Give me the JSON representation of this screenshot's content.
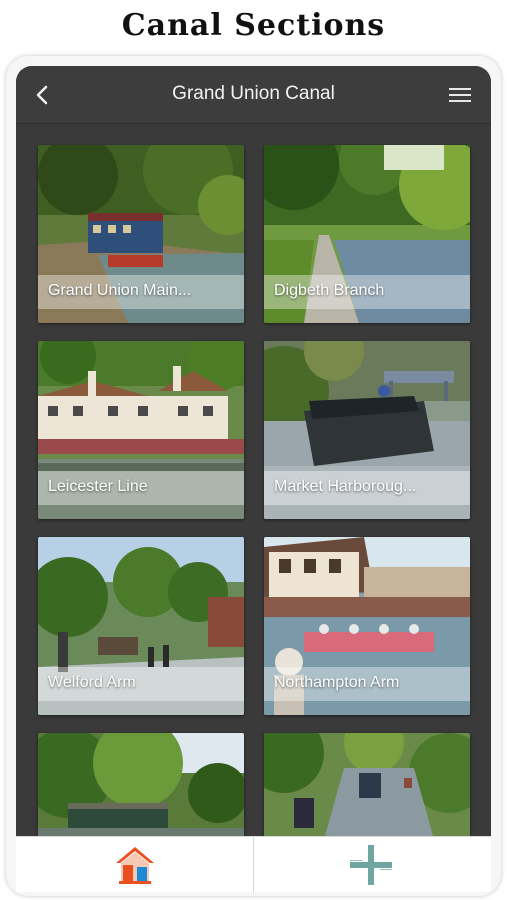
{
  "page": {
    "title": "Canal Sections"
  },
  "appbar": {
    "title": "Grand Union Canal",
    "back_icon": "chevron-left-icon",
    "menu_icon": "hamburger-menu-icon"
  },
  "sections": [
    {
      "label": "Grand Union Main...",
      "image": "canal-narrowboat-photo"
    },
    {
      "label": "Digbeth Branch",
      "image": "canal-towpath-photo"
    },
    {
      "label": "Leicester Line",
      "image": "canal-pub-building-photo"
    },
    {
      "label": "Market Harboroug...",
      "image": "canal-narrowboat-bridge-photo"
    },
    {
      "label": "Welford Arm",
      "image": "canal-lock-photo"
    },
    {
      "label": "Northampton Arm",
      "image": "canal-boats-waterfront-photo"
    },
    {
      "label": "",
      "image": "canal-willow-boats-photo"
    },
    {
      "label": "",
      "image": "canal-river-boats-photo"
    }
  ],
  "bottom_nav": {
    "home_icon": "home-icon",
    "add_icon": "add-plus-icon"
  },
  "colors": {
    "appbar": "#3d3d3d",
    "background": "#3a3a3a",
    "home_roof": "#e8501e",
    "home_door": "#1d8ad6",
    "add": "#6fa6a0"
  }
}
